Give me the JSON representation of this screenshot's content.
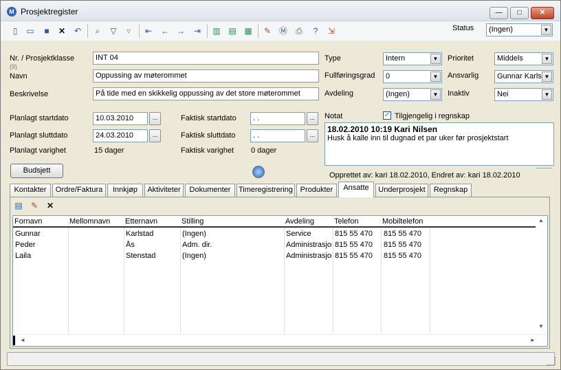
{
  "window": {
    "title": "Prosjektregister"
  },
  "status": {
    "label": "Status",
    "value": "(Ingen)"
  },
  "form": {
    "nr_label": "Nr. / Prosjektklasse",
    "nr_sub": "(9)",
    "nr_value": "INT 04",
    "navn_label": "Navn",
    "navn_value": "Oppussing av møterommet",
    "beskrivelse_label": "Beskrivelse",
    "beskrivelse_value": "På tide med en skikkelig oppussing av det store møterommet",
    "type_label": "Type",
    "type_value": "Intern",
    "fullforing_label": "Fullføringsgrad",
    "fullforing_value": "0",
    "avdeling_label": "Avdeling",
    "avdeling_value": "(Ingen)",
    "prioritet_label": "Prioritet",
    "prioritet_value": "Middels",
    "ansvarlig_label": "Ansvarlig",
    "ansvarlig_value": "Gunnar Karlstad",
    "inaktiv_label": "Inaktiv",
    "inaktiv_value": "Nei",
    "plan_start_label": "Planlagt startdato",
    "plan_start_value": "10.03.2010",
    "plan_slutt_label": "Planlagt sluttdato",
    "plan_slutt_value": "24.03.2010",
    "plan_varighet_label": "Planlagt varighet",
    "plan_varighet_value": "15 dager",
    "fakt_start_label": "Faktisk startdato",
    "fakt_start_value": ". .",
    "fakt_slutt_label": "Faktisk sluttdato",
    "fakt_slutt_value": ". .",
    "fakt_varighet_label": "Faktisk varighet",
    "fakt_varighet_value": "0 dager",
    "dots": "...",
    "budsjett_label": "Budsjett"
  },
  "notes": {
    "label": "Notat",
    "checkbox_label": "Tilgjengelig i regnskap",
    "checked": true,
    "heading": "18.02.2010 10:19 Kari Nilsen",
    "text": "Husk å kalle inn til dugnad et par uker før prosjektstart",
    "created": "Opprettet av: kari 18.02.2010, Endret av: kari 18.02.2010"
  },
  "tabs": [
    "Kontakter",
    "Ordre/Faktura",
    "Innkjøp",
    "Aktiviteter",
    "Dokumenter",
    "Timeregistrering",
    "Produkter",
    "Ansatte",
    "Underprosjekt",
    "Regnskap"
  ],
  "active_tab": "Ansatte",
  "grid": {
    "headers": [
      "Fornavn",
      "Mellomnavn",
      "Etternavn",
      "Stilling",
      "Avdeling",
      "Telefon",
      "Mobiltelefon"
    ],
    "rows": [
      [
        "Gunnar",
        "",
        "Karlstad",
        "(Ingen)",
        "Service",
        "815 55 470",
        "815 55 470"
      ],
      [
        "Peder",
        "",
        "Ås",
        "Adm. dir.",
        "Administrasjon",
        "815 55 470",
        "815 55 470"
      ],
      [
        "Laila",
        "",
        "Stenstad",
        "(Ingen)",
        "Administrasjon",
        "815 55 470",
        "815 55 470"
      ]
    ]
  },
  "icons": {
    "arrow_down": "▼",
    "arrow_up": "▲",
    "arrow_left": "◄",
    "arrow_right": "►",
    "checkmark": "✓",
    "close": "✕",
    "minimize": "—",
    "maximize": "□"
  }
}
